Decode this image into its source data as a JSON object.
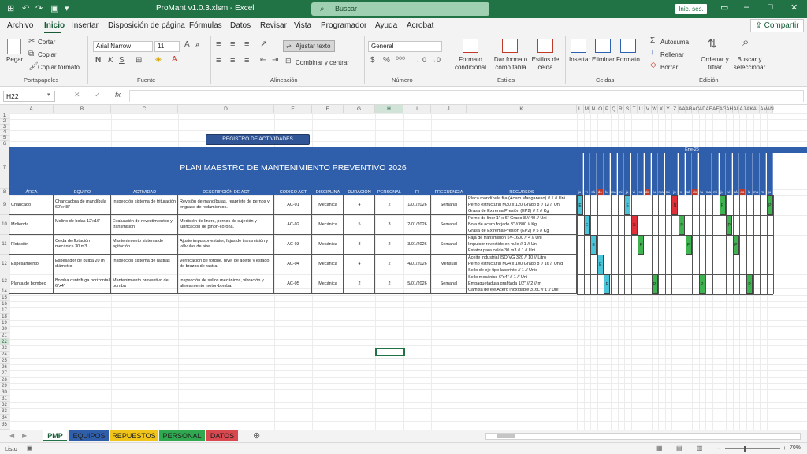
{
  "titlebar": {
    "file_title": "ProMant v1.0.3.xlsm - Excel",
    "search_placeholder": "Buscar",
    "signin": "Inic. ses."
  },
  "menu": [
    "Archivo",
    "Inicio",
    "Insertar",
    "Disposición de página",
    "Fórmulas",
    "Datos",
    "Revisar",
    "Vista",
    "Programador",
    "Ayuda",
    "Acrobat"
  ],
  "share": "Compartir",
  "ribbon": {
    "paste": "Pegar",
    "cut": "Cortar",
    "copy": "Copiar",
    "format_painter": "Copiar formato",
    "group_clipboard": "Portapapeles",
    "font_name": "Arial Narrow",
    "font_size": "11",
    "group_font": "Fuente",
    "wrap": "Ajustar texto",
    "merge": "Combinar y centrar",
    "group_align": "Alineación",
    "number_format": "General",
    "group_number": "Número",
    "cond_format": "Formato condicional",
    "format_table": "Dar formato como tabla",
    "cell_styles": "Estilos de celda",
    "group_styles": "Estilos",
    "insert": "Insertar",
    "delete": "Eliminar",
    "format": "Formato",
    "group_cells": "Celdas",
    "autosum": "Autosuma",
    "fill": "Rellenar",
    "clear": "Borrar",
    "sort": "Ordenar y filtrar",
    "find": "Buscar y seleccionar",
    "group_edit": "Edición"
  },
  "namebox": "H22",
  "fx": "fx",
  "columns": [
    "A",
    "B",
    "C",
    "D",
    "E",
    "F",
    "G",
    "H",
    "I",
    "J",
    "K"
  ],
  "day_columns": [
    "L",
    "M",
    "N",
    "O",
    "P",
    "Q",
    "R",
    "S",
    "T",
    "U",
    "V",
    "W",
    "X",
    "Y",
    "Z",
    "AA",
    "AB",
    "AC",
    "AD",
    "AE",
    "AF",
    "AG",
    "AH",
    "AI",
    "AJ",
    "AK",
    "AL",
    "AM",
    "AN"
  ],
  "register_button": "REGISTRO DE ACTIVIDADES",
  "plan_title": "PLAN MAESTRO DE MANTENIMIENTO PREVENTIVO 2026",
  "month_label": "Ene-26",
  "table_headers": [
    "ÁREA",
    "EQUIPO",
    "ACTIVIDAD",
    "DESCRIPCIÓN DE ACT",
    "CODIGO ACT",
    "DISCIPLINA",
    "DURACIÓN",
    "PERSONAL",
    "FI",
    "FRECUENCIA",
    "RECURSOS"
  ],
  "dates": [
    "1/01/2026",
    "2/01/2026",
    "3/01/2026",
    "4/01/2026",
    "5/01/2026",
    "6/01/2026",
    "7/01/2026",
    "8/01/2026",
    "9/01/2026",
    "10/01/2026",
    "11/01/2026",
    "12/01/2026",
    "13/01/2026",
    "14/01/2026",
    "15/01/2026",
    "16/01/2026",
    "17/01/2026",
    "18/01/2026",
    "19/01/2026",
    "20/01/2026",
    "21/01/2026",
    "22/01/2026",
    "23/01/2026",
    "24/01/2026",
    "25/01/2026",
    "26/01/2026",
    "27/01/2026",
    "28/01/2026",
    "29/01/2026"
  ],
  "weekdays": [
    "ju",
    "vi",
    "sá",
    "do",
    "lu",
    "ma",
    "mi",
    "ju",
    "vi",
    "sá",
    "do",
    "lu",
    "ma",
    "mi",
    "ju",
    "vi",
    "sá",
    "do",
    "lu",
    "ma",
    "mi",
    "ju",
    "vi",
    "sá",
    "do",
    "lu",
    "ma",
    "mi",
    "ju"
  ],
  "rows": [
    {
      "area": "Chancado",
      "equipo": "Chancadora de mandíbula 60\"x48\"",
      "actividad": "Inspección sistema de trituración",
      "descripcion": "Revisión de mandíbulas, reapriete de pernos y engrase de rodamientos.",
      "codigo": "AC-01",
      "disciplina": "Mecánica",
      "duracion": "4",
      "personal": "2",
      "fi": "1/01/2026",
      "frecuencia": "Semanal",
      "recursos": [
        "Placa mandíbula fija (Acero Manganeso) // 1 // Uni",
        "Perno estructural M30 x 120 Grado 8 // 12 // Uni",
        "Grasa de Extrema Presión (EP2) // 2 // Kg"
      ],
      "marks": [
        [
          0,
          "E"
        ],
        [
          7,
          "E"
        ],
        [
          14,
          "N"
        ],
        [
          21,
          "P"
        ],
        [
          28,
          "P"
        ]
      ]
    },
    {
      "area": "Molienda",
      "equipo": "Molino de bolas 12'x16'",
      "actividad": "Evaluación de revestimientos y transmisión",
      "descripcion": "Medición de liners, pernos de sujeción y lubricación de piñón-corona.",
      "codigo": "AC-02",
      "disciplina": "Mecánica",
      "duracion": "5",
      "personal": "3",
      "fi": "2/01/2026",
      "frecuencia": "Semanal",
      "recursos": [
        "Perno de liner 1\" x 6\" Grado 8 // 40 // Uni",
        "Bola de acero forjado 3\" // 800 // Kg",
        "Grasa de Extrema Presión (EP2) // 5 // Kg"
      ],
      "marks": [
        [
          1,
          "E"
        ],
        [
          8,
          "N"
        ],
        [
          15,
          "P"
        ],
        [
          22,
          "P"
        ]
      ]
    },
    {
      "area": "Flotación",
      "equipo": "Celda de flotación mecánica 30 m3",
      "actividad": "Mantenimiento sistema de agitación",
      "descripcion": "Ajuste impulsor-estator, fajas de transmisión y válvulas de aire.",
      "codigo": "AC-03",
      "disciplina": "Mecánica",
      "duracion": "3",
      "personal": "2",
      "fi": "3/01/2026",
      "frecuencia": "Semanal",
      "recursos": [
        "Faja de transmisión 5V-1600 // 4 // Uni",
        "Impulsor revestido en hule // 1 // Uni",
        "Estator para celda 30 m3 // 1 // Uni"
      ],
      "marks": [
        [
          2,
          "E"
        ],
        [
          9,
          "P"
        ],
        [
          16,
          "P"
        ],
        [
          23,
          "P"
        ]
      ]
    },
    {
      "area": "Espesamiento",
      "equipo": "Espesador de pulpa 20 m diámetro",
      "actividad": "Inspección sistema de rastras",
      "descripcion": "Verificación de torque, nivel de aceite y estado de brazos de rastra.",
      "codigo": "AC-04",
      "disciplina": "Mecánica",
      "duracion": "4",
      "personal": "2",
      "fi": "4/01/2026",
      "frecuencia": "Mensual",
      "recursos": [
        "Aceite industrial ISO VG 320 // 10 // Litro",
        "Perno estructural M24 x 100 Grado 8 // 16 // Unid",
        "Sello de eje tipo laberinto // 1 // Unid"
      ],
      "marks": [
        [
          3,
          "E"
        ]
      ]
    },
    {
      "area": "Planta de bombeo",
      "equipo": "Bomba centrífuga horizontal 6\"x4\"",
      "actividad": "Mantenimiento preventivo de bomba",
      "descripcion": "Inspección de sellos mecánicos, vibración y alineamiento motor-bomba.",
      "codigo": "AC-05",
      "disciplina": "Mecánica",
      "duracion": "2",
      "personal": "2",
      "fi": "5/01/2026",
      "frecuencia": "Semanal",
      "recursos": [
        "Sello mecánico 6\"x4\" // 1 // Uni",
        "Empaquetadura grafitada 1/2\" // 2 // m",
        "Camisa de eje Acero Inoxidable 316L // 1 // Uni"
      ],
      "marks": [
        [
          4,
          "E"
        ],
        [
          11,
          "P"
        ],
        [
          18,
          "P"
        ],
        [
          25,
          "P"
        ]
      ]
    }
  ],
  "sheet_tabs": [
    {
      "label": "PMP",
      "color": "#ffffff"
    },
    {
      "label": "EQUIPOS",
      "color": "#2f5fab"
    },
    {
      "label": "REPUESTOS",
      "color": "#f0c419"
    },
    {
      "label": "PERSONAL",
      "color": "#2fa84f"
    },
    {
      "label": "DATOS",
      "color": "#d9474f"
    }
  ],
  "status": {
    "mode": "Listo",
    "zoom": "70%"
  }
}
